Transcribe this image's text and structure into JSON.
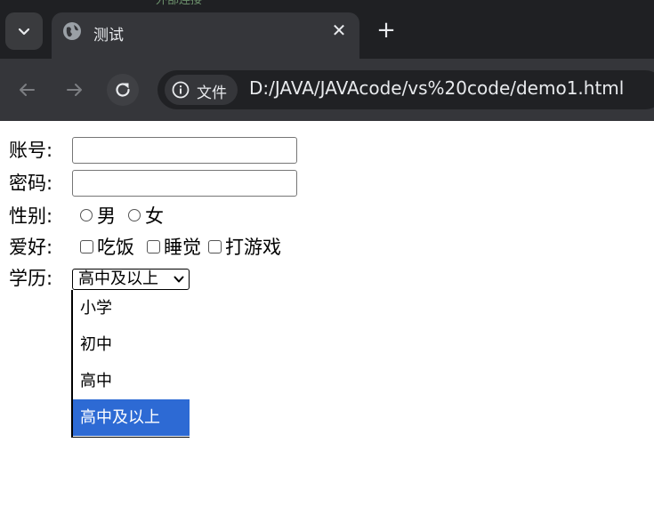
{
  "browser": {
    "ghost_tab_text": "外部连接",
    "tab_title": "测试",
    "site_chip": "文件",
    "url": "D:/JAVA/JAVAcode/vs%20code/demo1.html"
  },
  "form": {
    "account_label": "账号:",
    "password_label": "密码:",
    "gender_label": "性别:",
    "gender_options": [
      "男",
      "女"
    ],
    "hobby_label": "爱好:",
    "hobby_options": [
      "吃饭",
      "睡觉",
      "打游戏"
    ],
    "education_label": "学历:",
    "education_selected": "高中及以上",
    "education_options": [
      "小学",
      "初中",
      "高中",
      "高中及以上"
    ]
  },
  "colors": {
    "selected_option_bg": "#2d6ad4"
  }
}
